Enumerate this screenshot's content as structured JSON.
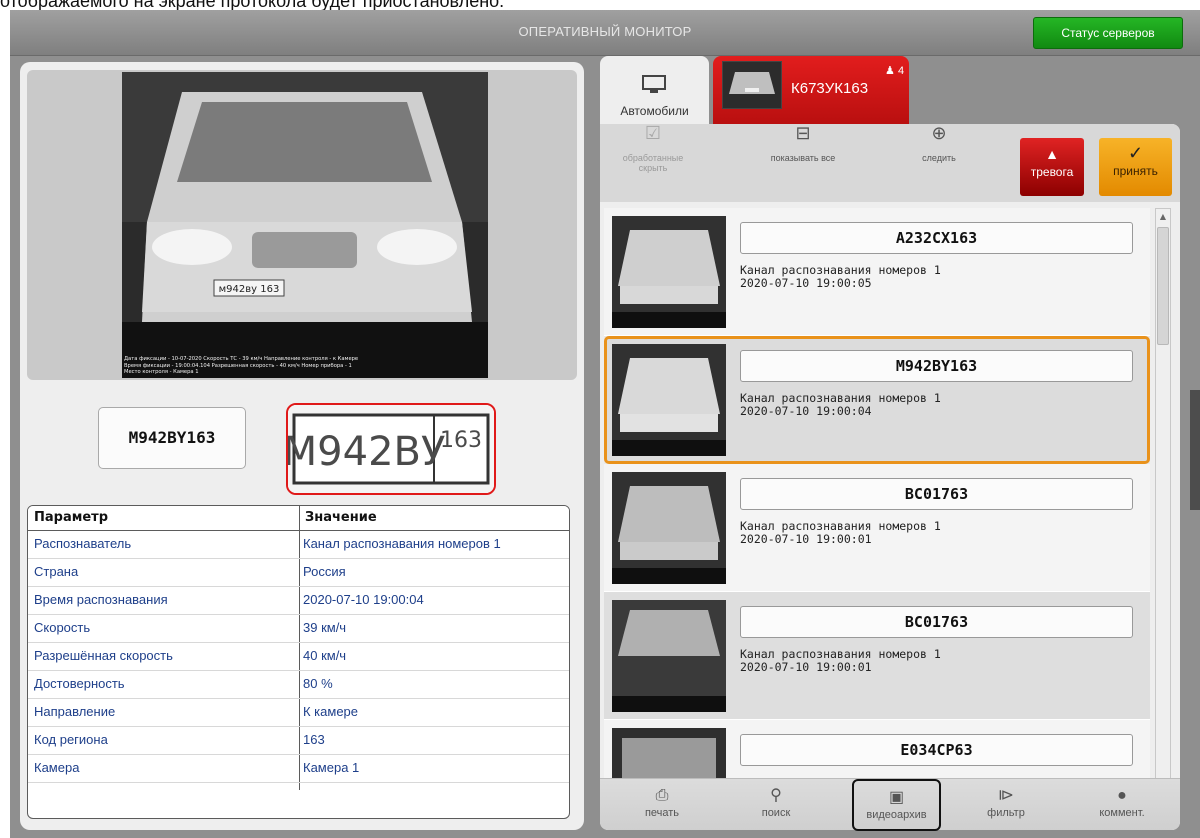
{
  "caption": "отображаемого на экране протокола будет приостановлено.",
  "window": {
    "title": "ОПЕРАТИВНЫЙ МОНИТОР",
    "server_status_label": "Статус серверов"
  },
  "snapshot": {
    "overlay_lines": [
      "Дата фиксации - 10-07-2020  Скорость ТС - 39 км/ч          Направление контроля - к Камере",
      "Время фиксации - 19:00:04.104     Разрешенная скорость - 40 км/ч        Номер прибора - 1",
      "Место контроля - Камера 1"
    ],
    "plate_on_car": "м942ву 163"
  },
  "recognized": {
    "plate": "M942BY163",
    "crop_text": "М942ВУ",
    "crop_region": "163"
  },
  "details_table": {
    "headers": [
      "Параметр",
      "Значение"
    ],
    "rows": [
      [
        "Распознаватель",
        "Канал распознавания номеров 1"
      ],
      [
        "Страна",
        "Россия"
      ],
      [
        "Время распознавания",
        "2020-07-10 19:00:04"
      ],
      [
        "Скорость",
        "39 км/ч"
      ],
      [
        "Разрешённая скорость",
        "40 км/ч"
      ],
      [
        "Достоверность",
        "80 %"
      ],
      [
        "Направление",
        "К камере"
      ],
      [
        "Код региона",
        "163"
      ],
      [
        "Камера",
        "Камера 1"
      ]
    ]
  },
  "tabs": {
    "auto_label": "Автомобили",
    "alarm_plate": "К673УК163",
    "alarm_count": "4"
  },
  "toolbar": {
    "hide_processed": "обработанные скрыть",
    "show_all": "показывать все",
    "follow": "следить",
    "alarm": "тревога",
    "accept": "принять"
  },
  "events": [
    {
      "plate": "A232CX163",
      "channel": "Канал распознавания номеров 1",
      "time": "2020-07-10 19:00:05",
      "style": "white"
    },
    {
      "plate": "M942BY163",
      "channel": "Канал распознавания номеров 1",
      "time": "2020-07-10 19:00:04",
      "style": "selected"
    },
    {
      "plate": "BC01763",
      "channel": "Канал распознавания номеров 1",
      "time": "2020-07-10 19:00:01",
      "style": "white"
    },
    {
      "plate": "BC01763",
      "channel": "Канал распознавания номеров 1",
      "time": "2020-07-10 19:00:01",
      "style": "grey"
    },
    {
      "plate": "E034CP63",
      "channel": "",
      "time": "",
      "style": "white"
    }
  ],
  "bottom_bar": {
    "print": "печать",
    "search": "поиск",
    "video_archive": "видеоархив",
    "filter": "фильтр",
    "comment": "коммент."
  },
  "icons": {
    "auto_tab": "monitor-icon",
    "alarm_tab": "bell-icon",
    "hide_processed": "check-icon",
    "show_all": "grid-icon",
    "follow": "target-icon",
    "alarm": "bell-icon",
    "accept": "check-icon",
    "print": "printer-icon",
    "search": "search-icon",
    "video_archive": "film-icon",
    "filter": "filter-icon",
    "comment": "comment-icon"
  },
  "colors": {
    "server_status": "#1a9e1a",
    "alarm_tab": "#d11a1a",
    "accept_button": "#f0a21a",
    "selected_border": "#e9921b",
    "crop_border": "#e01919"
  }
}
